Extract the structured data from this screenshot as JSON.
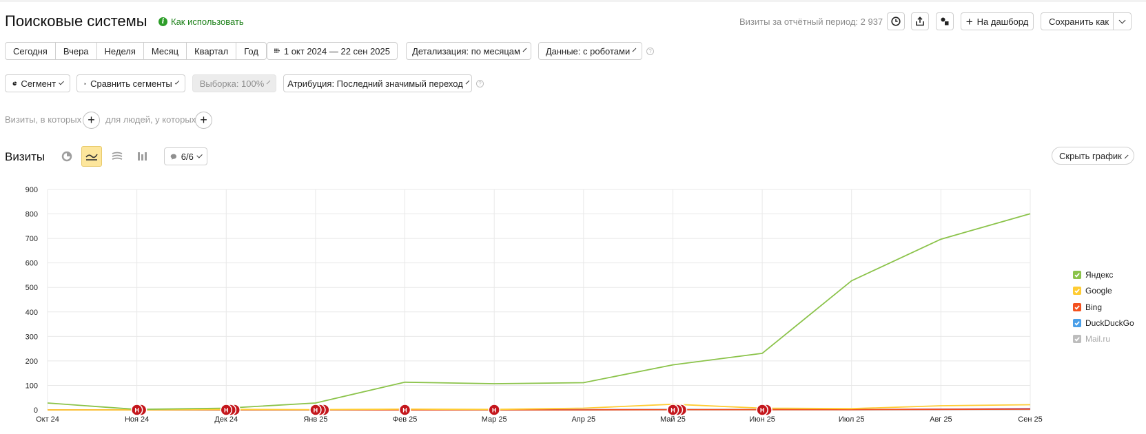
{
  "header": {
    "title": "Поисковые системы",
    "how_to_use": "Как использовать",
    "visits_total": "Визиты за отчётный период: 2 937",
    "to_dashboard": "На дашборд",
    "save_as": "Сохранить как"
  },
  "period_buttons": [
    "Сегодня",
    "Вчера",
    "Неделя",
    "Месяц",
    "Квартал",
    "Год"
  ],
  "date_range": "1 окт 2024 — 22 сен 2025",
  "detail": "Детализация: по месяцам",
  "data_robots": "Данные: с роботами",
  "segment": "Сегмент",
  "compare_segments": "Сравнить сегменты",
  "sample": "Выборка: 100%",
  "attribution": "Атрибуция: Последний значимый переход",
  "filters": {
    "visits_where": "Визиты, в которых",
    "people_where": "для людей, у которых"
  },
  "chart_section": {
    "title": "Визиты",
    "annotations_count": "6/6",
    "hide_chart": "Скрыть график"
  },
  "colors": {
    "yandex": "#8bc34a",
    "google": "#ffcc33",
    "bing": "#f4511e",
    "duckduckgo": "#4a9fe8",
    "mailru": "#bdbdbd",
    "other": "#9c27b0",
    "marker": "#c4161c"
  },
  "chart_data": {
    "type": "line",
    "categories": [
      "Окт 24",
      "Ноя 24",
      "Дек 24",
      "Янв 25",
      "Фев 25",
      "Мар 25",
      "Апр 25",
      "Май 25",
      "Июн 25",
      "Июл 25",
      "Авг 25",
      "Сен 25"
    ],
    "ylim": [
      0,
      900
    ],
    "yticks": [
      0,
      100,
      200,
      300,
      400,
      500,
      600,
      700,
      800,
      900
    ],
    "grid": true,
    "legend_position": "right",
    "series": [
      {
        "name": "Яндекс",
        "color": "#8bc34a",
        "values": [
          28,
          2,
          7,
          28,
          113,
          107,
          111,
          184,
          231,
          527,
          697,
          801
        ]
      },
      {
        "name": "Google",
        "color": "#ffcc33",
        "values": [
          0,
          0,
          2,
          1,
          3,
          2,
          7,
          23,
          7,
          5,
          17,
          21
        ]
      },
      {
        "name": "Bing",
        "color": "#f4511e",
        "values": [
          0,
          0,
          0,
          0,
          0,
          0,
          0,
          1,
          1,
          1,
          2,
          3
        ]
      },
      {
        "name": "DuckDuckGo",
        "color": "#4a9fe8",
        "values": [
          0,
          0,
          0,
          0,
          1,
          0,
          0,
          2,
          1,
          1,
          2,
          4
        ]
      },
      {
        "name": "Mail.ru",
        "color": "#bdbdbd",
        "values": [
          0,
          0,
          0,
          0,
          0,
          0,
          0,
          0,
          0,
          0,
          1,
          1
        ],
        "muted": true
      },
      {
        "name": "",
        "color": "#9c27b0",
        "values": [
          0,
          0,
          0,
          0,
          0,
          0,
          1,
          1,
          1,
          1,
          3,
          5
        ]
      }
    ],
    "annotations": [
      {
        "x": 1,
        "count": 2,
        "label": "Н"
      },
      {
        "x": 2,
        "count": 3,
        "label": "Н"
      },
      {
        "x": 3,
        "count": 3,
        "label": "Н"
      },
      {
        "x": 4,
        "count": 1,
        "label": "Н"
      },
      {
        "x": 5,
        "count": 1,
        "label": "Н"
      },
      {
        "x": 7,
        "count": 3,
        "label": "Н"
      },
      {
        "x": 8,
        "count": 2,
        "label": "Н"
      }
    ]
  }
}
